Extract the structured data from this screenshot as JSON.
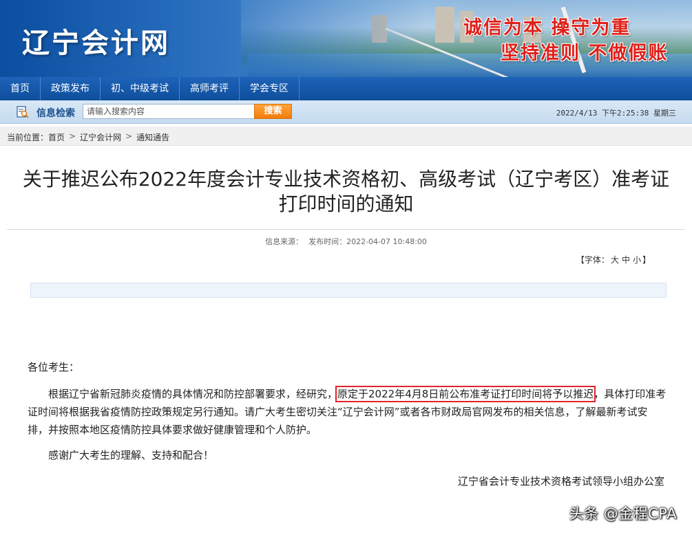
{
  "header": {
    "logo_text": "辽宁会计网",
    "slogan_line1": "诚信为本 操守为重",
    "slogan_line2": "坚持准则 不做假账"
  },
  "nav": {
    "items": [
      {
        "label": "首页"
      },
      {
        "label": "政策发布"
      },
      {
        "label": "初、中级考试"
      },
      {
        "label": "高师考评"
      },
      {
        "label": "学会专区"
      }
    ]
  },
  "search": {
    "label": "信息检索",
    "placeholder": "请输入搜索内容",
    "button_label": "搜索",
    "datetime": "2022/4/13 下午2:25:38 星期三"
  },
  "breadcrumb": {
    "prefix": "当前位置：",
    "items": [
      "首页",
      "辽宁会计网",
      "通知通告"
    ],
    "separator": ">"
  },
  "article": {
    "title": "关于推迟公布2022年度会计专业技术资格初、高级考试（辽宁考区）准考证打印时间的通知",
    "source_label": "信息来源：",
    "published_label": "发布时间：",
    "published_time": "2022-04-07 10:48:00",
    "font_size_prefix": "【字体：",
    "font_size_large": "大",
    "font_size_medium": "中",
    "font_size_small": "小",
    "font_size_suffix": "】",
    "greeting": "各位考生：",
    "para1_before": "根据辽宁省新冠肺炎疫情的具体情况和防控部署要求，经研究，",
    "para1_highlight": "原定于2022年4月8日前公布准考证打印时间将予以推迟",
    "para1_after": "，具体打印准考证时间将根据我省疫情防控政策规定另行通知。请广大考生密切关注“辽宁会计网”或者各市财政局官网发布的相关信息，了解最新考试安排，并按照本地区疫情防控具体要求做好健康管理和个人防护。",
    "para2": "感谢广大考生的理解、支持和配合！",
    "signature": "辽宁省会计专业技术资格考试领导小组办公室"
  },
  "watermark": "头条 @金程CPA",
  "colors": {
    "nav_bg": "#0f4e9c",
    "search_button": "#f27d0c",
    "highlight_box": "#e4232a",
    "slogan": "#e0201a"
  }
}
